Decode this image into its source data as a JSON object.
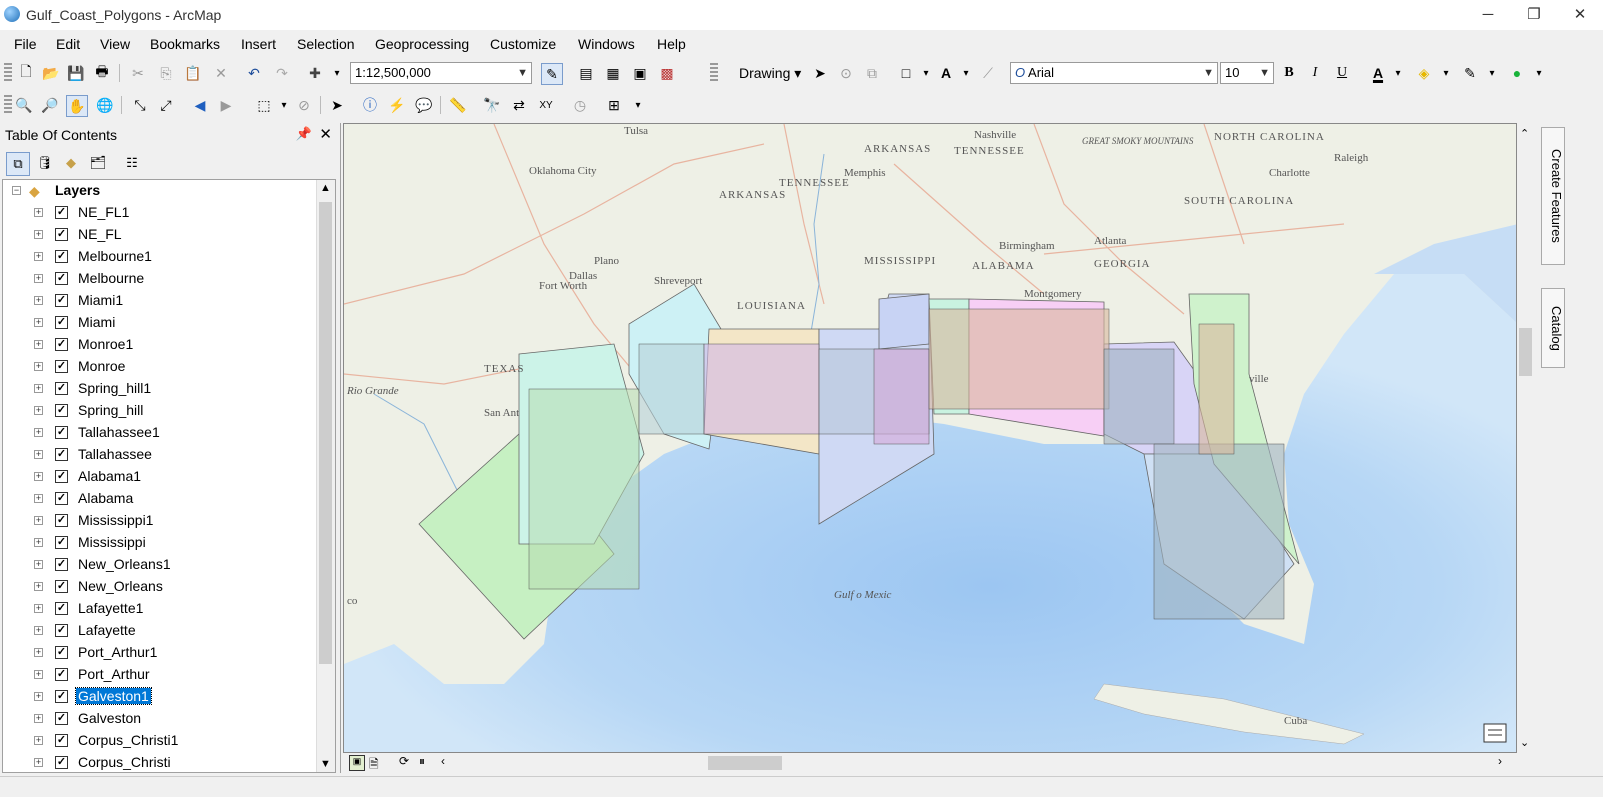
{
  "window": {
    "title": "Gulf_Coast_Polygons - ArcMap",
    "minimize_glyph": "─",
    "restore_glyph": "❐",
    "close_glyph": "✕"
  },
  "menu": [
    "File",
    "Edit",
    "View",
    "Bookmarks",
    "Insert",
    "Selection",
    "Geoprocessing",
    "Customize",
    "Windows",
    "Help"
  ],
  "toolbar": {
    "scale": "1:12,500,000",
    "drawing_label": "Drawing",
    "font_name": "Arial",
    "font_size": "10",
    "bold": "B",
    "italic": "I",
    "underline": "U",
    "font_color": "A"
  },
  "toc": {
    "title": "Table Of Contents",
    "root_label": "Layers",
    "layers": [
      {
        "name": "NE_FL1",
        "checked": true
      },
      {
        "name": "NE_FL",
        "checked": true
      },
      {
        "name": "Melbourne1",
        "checked": true
      },
      {
        "name": "Melbourne",
        "checked": true
      },
      {
        "name": "Miami1",
        "checked": true
      },
      {
        "name": "Miami",
        "checked": true
      },
      {
        "name": "Monroe1",
        "checked": true
      },
      {
        "name": "Monroe",
        "checked": true
      },
      {
        "name": "Spring_hill1",
        "checked": true
      },
      {
        "name": "Spring_hill",
        "checked": true
      },
      {
        "name": "Tallahassee1",
        "checked": true
      },
      {
        "name": "Tallahassee",
        "checked": true
      },
      {
        "name": "Alabama1",
        "checked": true
      },
      {
        "name": "Alabama",
        "checked": true
      },
      {
        "name": "Mississippi1",
        "checked": true
      },
      {
        "name": "Mississippi",
        "checked": true
      },
      {
        "name": "New_Orleans1",
        "checked": true
      },
      {
        "name": "New_Orleans",
        "checked": true
      },
      {
        "name": "Lafayette1",
        "checked": true
      },
      {
        "name": "Lafayette",
        "checked": true
      },
      {
        "name": "Port_Arthur1",
        "checked": true
      },
      {
        "name": "Port_Arthur",
        "checked": true
      },
      {
        "name": "Galveston1",
        "checked": true,
        "selected": true
      },
      {
        "name": "Galveston",
        "checked": true
      },
      {
        "name": "Corpus_Christi1",
        "checked": true
      },
      {
        "name": "Corpus_Christi",
        "checked": true
      }
    ]
  },
  "map": {
    "labels": [
      "ARKANSAS",
      "TENNESSEE",
      "Nashville",
      "NORTH CAROLINA",
      "Raleigh",
      "Charlotte",
      "SOUTH CAROLINA",
      "Oklahoma City",
      "Memphis",
      "TENNESSEE",
      "ARKANSAS",
      "MISSISSIPPI",
      "ALABAMA",
      "GEORGIA",
      "Birmingham",
      "Atlanta",
      "Montgomery",
      "LOUISIANA",
      "Shreveport",
      "Dallas",
      "Plano",
      "Fort Worth",
      "TEXAS",
      "San Ant",
      "Rio Grande",
      "Gulf o Mexic",
      "Cuba",
      "ville",
      "co",
      "Tulsa",
      "GREAT SMOKY MOUNTAINS"
    ],
    "polygon_colors": [
      "#c9f2e8",
      "#cdeef2",
      "#f2e2c4",
      "#e2c9f2",
      "#c9d4f2",
      "#f7d3f7",
      "#c9f2c9",
      "#d6d2f5",
      "#f2cfd8"
    ]
  },
  "dock": {
    "create_features": "Create Features",
    "catalog": "Catalog"
  }
}
